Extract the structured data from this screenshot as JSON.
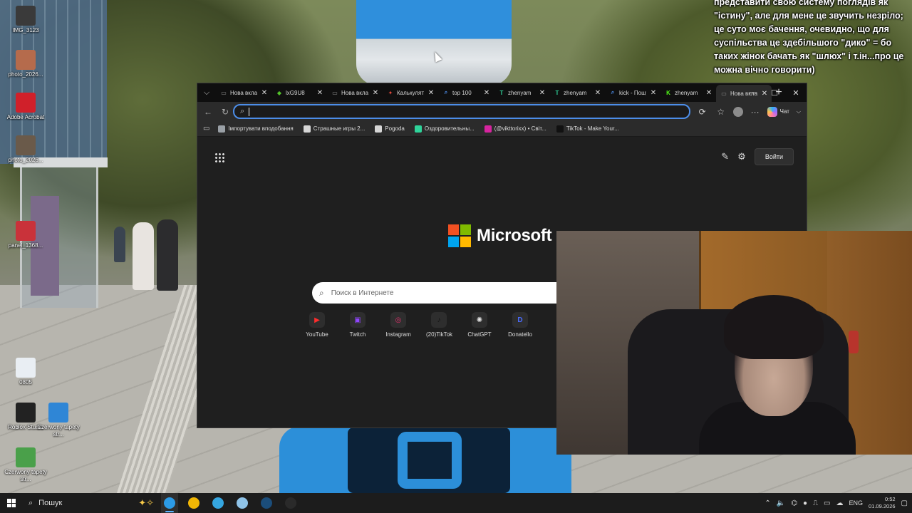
{
  "desktop": {
    "icons": [
      {
        "label": "IMG_3123",
        "color": "#3a3a3a"
      },
      {
        "label": "photo_2026...",
        "color": "#b56b4c"
      },
      {
        "label": "Adobe Acrobat",
        "color": "#d0202a"
      },
      {
        "label": "photo_2026...",
        "color": "#6a5a4a"
      },
      {
        "label": "panel_1368...",
        "color": "#c9323a"
      },
      {
        "label": "0805",
        "color": "#e9eef3"
      },
      {
        "label": "Roblox Studio",
        "color": "#222222"
      },
      {
        "label": "Czerwony tapety str...",
        "color": "#2f86d6"
      },
      {
        "label": "Czerwony tapety str...",
        "color": "#4aa04a"
      }
    ]
  },
  "overlay": {
    "text": "представити свою систему поглядів як \"істину\", але для мене це звучить незріло; це суто моє бачення, очевидно, що для суспільства це здебільшого \"дико\" = бо таких жінок бачать як \"шлюх\" і т.ін...про це можна вічно говорити)"
  },
  "browser": {
    "tabs": [
      {
        "title": "Нова вкладка",
        "icon": "tab-page-icon",
        "color": "#888888",
        "glyph": "▭"
      },
      {
        "title": "lxG9U8",
        "icon": "green-logo-icon",
        "color": "#53c32a",
        "glyph": "◆"
      },
      {
        "title": "Нова вкладка",
        "icon": "tab-page-icon",
        "color": "#888888",
        "glyph": "▭"
      },
      {
        "title": "Калькулятор",
        "icon": "red-logo-icon",
        "color": "#e2483b",
        "glyph": "✦"
      },
      {
        "title": "top 100",
        "icon": "search-icon",
        "color": "#4c8de8",
        "glyph": "⌕"
      },
      {
        "title": "zhenyam",
        "icon": "tiktok-tracker-icon",
        "color": "#2fd39a",
        "glyph": "T"
      },
      {
        "title": "zhenyam",
        "icon": "tiktok-tracker-icon",
        "color": "#2fd39a",
        "glyph": "T"
      },
      {
        "title": "kick - Пошук",
        "icon": "search-icon",
        "color": "#4c8de8",
        "glyph": "⌕"
      },
      {
        "title": "zhenyam",
        "icon": "kick-icon",
        "color": "#53fc18",
        "glyph": "K"
      },
      {
        "title": "Нова вкладка",
        "icon": "tab-page-icon",
        "color": "#888888",
        "glyph": "▭"
      }
    ],
    "address": {
      "value": "",
      "placeholder": ""
    },
    "copilot_label": "Чат",
    "bookmarks": [
      {
        "label": "Імпортувати вподобання",
        "color": "#9aa0a6"
      },
      {
        "label": "Страшные игры 2...",
        "color": "#d6d6d6"
      },
      {
        "label": "Pogoda",
        "color": "#d6d6d6"
      },
      {
        "label": "Оздоровительны...",
        "color": "#2fd39a"
      },
      {
        "label": "(@vikttorixx) • Світ...",
        "color": "#d6249f"
      },
      {
        "label": "TikTok - Make Your...",
        "color": "#111111"
      }
    ],
    "ntp": {
      "signin_label": "Войти",
      "brand": "Microsoft",
      "search_placeholder": "Поиск в Интернете",
      "quicklinks": [
        {
          "label": "YouTube",
          "color": "#ff2d2d",
          "glyph": "▶"
        },
        {
          "label": "Twitch",
          "color": "#9146ff",
          "glyph": "▣"
        },
        {
          "label": "Instagram",
          "color": "#e1306c",
          "glyph": "◎"
        },
        {
          "label": "(20)TikTok",
          "color": "#111111",
          "glyph": "♪"
        },
        {
          "label": "ChatGPT",
          "color": "#e5e5e5",
          "glyph": "✺"
        },
        {
          "label": "Donatello",
          "color": "#4b6cff",
          "glyph": "D"
        }
      ]
    }
  },
  "taskbar": {
    "search_label": "Пошук",
    "language": "ENG",
    "time": "0:52",
    "date": "01.09.2026",
    "apps": [
      {
        "name": "edge",
        "color": "#2c9be6",
        "active": true
      },
      {
        "name": "chrome",
        "color": "#f2b705",
        "active": false
      },
      {
        "name": "telegram",
        "color": "#35a6e0",
        "active": false
      },
      {
        "name": "notepad",
        "color": "#8fc3e8",
        "active": false
      },
      {
        "name": "steam",
        "color": "#1b4d7a",
        "active": false
      },
      {
        "name": "obs",
        "color": "#2a2a2a",
        "active": false
      }
    ]
  },
  "colors": {
    "accent": "#4c8de8",
    "browser_bg": "#1f1f1f",
    "ms_red": "#f25022",
    "ms_green": "#7fba00",
    "ms_blue": "#00a4ef",
    "ms_yellow": "#ffb900"
  }
}
